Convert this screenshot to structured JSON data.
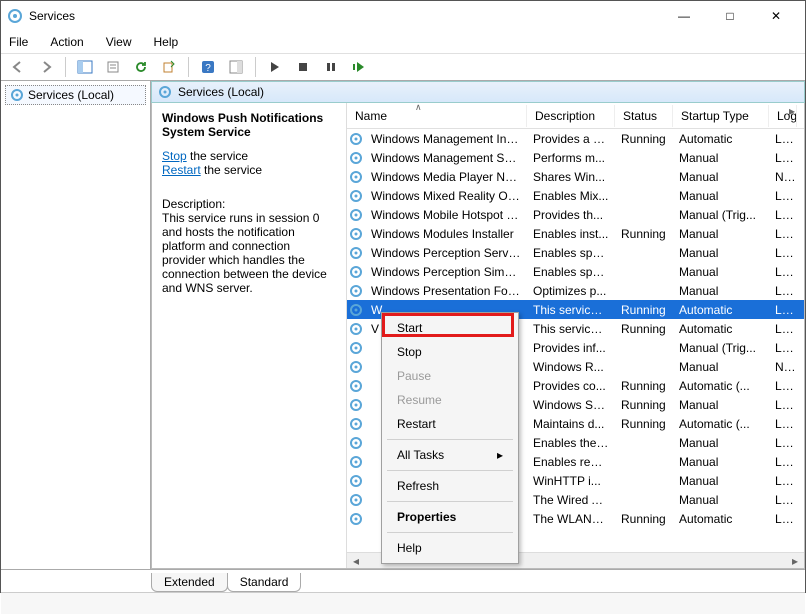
{
  "window": {
    "title": "Services",
    "minimize_icon": "—",
    "maximize_icon": "□",
    "close_icon": "✕"
  },
  "menu": {
    "file": "File",
    "action": "Action",
    "view": "View",
    "help": "Help"
  },
  "tree": {
    "root": "Services (Local)"
  },
  "pane": {
    "title": "Services (Local)"
  },
  "description_panel": {
    "service_name": "Windows Push Notifications System Service",
    "stop_link": "Stop",
    "stop_tail": " the service",
    "restart_link": "Restart",
    "restart_tail": " the service",
    "desc_label": "Description:",
    "desc_body": "This service runs in session 0 and hosts the notification platform and connection provider which handles the connection between the device and WNS server."
  },
  "columns": {
    "name": "Name",
    "description": "Description",
    "status": "Status",
    "startup": "Startup Type",
    "logon": "Log"
  },
  "rows": [
    {
      "name": "Windows Management Inst...",
      "desc": "Provides a c...",
      "status": "Running",
      "startup": "Automatic",
      "logon": "Loc"
    },
    {
      "name": "Windows Management Ser...",
      "desc": "Performs m...",
      "status": "",
      "startup": "Manual",
      "logon": "Loc"
    },
    {
      "name": "Windows Media Player Net...",
      "desc": "Shares Win...",
      "status": "",
      "startup": "Manual",
      "logon": "Net"
    },
    {
      "name": "Windows Mixed Reality Op...",
      "desc": "Enables Mix...",
      "status": "",
      "startup": "Manual",
      "logon": "Loc"
    },
    {
      "name": "Windows Mobile Hotspot S...",
      "desc": "Provides th...",
      "status": "",
      "startup": "Manual (Trig...",
      "logon": "Loc"
    },
    {
      "name": "Windows Modules Installer",
      "desc": "Enables inst...",
      "status": "Running",
      "startup": "Manual",
      "logon": "Loc"
    },
    {
      "name": "Windows Perception Service",
      "desc": "Enables spa...",
      "status": "",
      "startup": "Manual",
      "logon": "Loc"
    },
    {
      "name": "Windows Perception Simul...",
      "desc": "Enables spa...",
      "status": "",
      "startup": "Manual",
      "logon": "Loc"
    },
    {
      "name": "Windows Presentation Fou...",
      "desc": "Optimizes p...",
      "status": "",
      "startup": "Manual",
      "logon": "Loc"
    },
    {
      "name": "W",
      "desc": "This service ...",
      "status": "Running",
      "startup": "Automatic",
      "logon": "Loc",
      "selected": true
    },
    {
      "name": "V",
      "desc": "This service ...",
      "status": "Running",
      "startup": "Automatic",
      "logon": "Loc"
    },
    {
      "name": "",
      "desc": "Provides inf...",
      "status": "",
      "startup": "Manual (Trig...",
      "logon": "Loc"
    },
    {
      "name": "",
      "desc": "Windows R...",
      "status": "",
      "startup": "Manual",
      "logon": "Net"
    },
    {
      "name": "",
      "desc": "Provides co...",
      "status": "Running",
      "startup": "Automatic (...",
      "logon": "Loc"
    },
    {
      "name": "",
      "desc": "Windows Se...",
      "status": "Running",
      "startup": "Manual",
      "logon": "Loc"
    },
    {
      "name": "",
      "desc": "Maintains d...",
      "status": "Running",
      "startup": "Automatic (...",
      "logon": "Loc"
    },
    {
      "name": "",
      "desc": "Enables the ...",
      "status": "",
      "startup": "Manual",
      "logon": "Loc"
    },
    {
      "name": "",
      "desc": "Enables rem...",
      "status": "",
      "startup": "Manual",
      "logon": "Loc"
    },
    {
      "name": "",
      "desc": "WinHTTP i...",
      "status": "",
      "startup": "Manual",
      "logon": "Loc"
    },
    {
      "name": "",
      "desc": "The Wired A...",
      "status": "",
      "startup": "Manual",
      "logon": "Loc"
    },
    {
      "name": "",
      "desc": "The WLANS...",
      "status": "Running",
      "startup": "Automatic",
      "logon": "Loc"
    }
  ],
  "tabs": {
    "extended": "Extended",
    "standard": "Standard"
  },
  "context_menu": {
    "start": "Start",
    "stop": "Stop",
    "pause": "Pause",
    "resume": "Resume",
    "restart": "Restart",
    "all_tasks": "All Tasks",
    "refresh": "Refresh",
    "properties": "Properties",
    "help": "Help"
  }
}
